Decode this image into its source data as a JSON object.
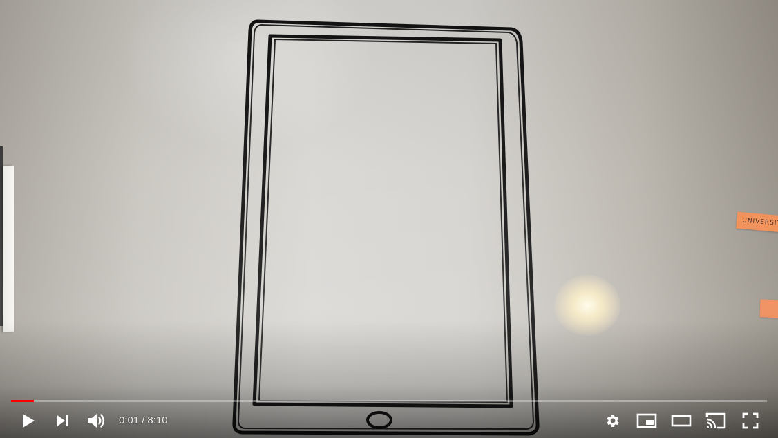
{
  "player": {
    "progress_fraction": 0.002,
    "accent_color": "#ff0000",
    "time": {
      "current": "0:01",
      "separator": "/",
      "duration": "8:10"
    },
    "controls_left": [
      "play-icon",
      "next-icon",
      "volume-icon"
    ],
    "controls_right": [
      "settings-icon",
      "miniplayer-icon",
      "theater-icon",
      "cast-icon",
      "fullscreen-icon"
    ]
  },
  "scene": {
    "sticky_note_text": "UNIVERSIT"
  }
}
